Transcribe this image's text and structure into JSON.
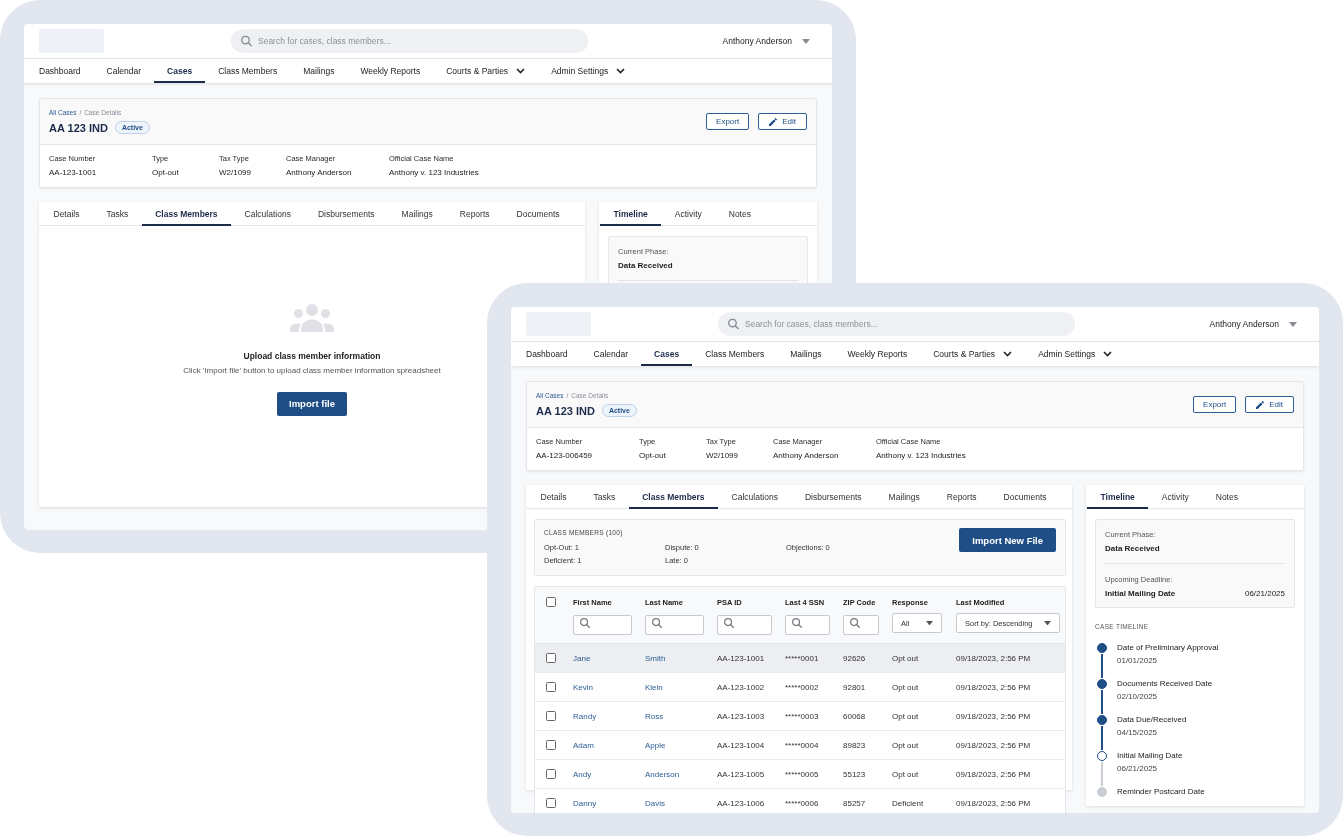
{
  "windows": [
    {
      "search": {
        "placeholder": "Search for cases, class members..."
      },
      "user": {
        "name": "Anthony Anderson"
      },
      "nav": [
        {
          "label": "Dashboard",
          "selected": false,
          "menu": false
        },
        {
          "label": "Calendar",
          "selected": false,
          "menu": false
        },
        {
          "label": "Cases",
          "selected": true,
          "menu": false
        },
        {
          "label": "Class Members",
          "selected": false,
          "menu": false
        },
        {
          "label": "Mailings",
          "selected": false,
          "menu": false
        },
        {
          "label": "Weekly Reports",
          "selected": false,
          "menu": false
        },
        {
          "label": "Courts & Parties",
          "selected": false,
          "menu": true
        },
        {
          "label": "Admin Settings",
          "selected": false,
          "menu": true
        }
      ],
      "breadcrumb": {
        "link": "All Cases",
        "separator": "/",
        "current": "Case Details"
      },
      "case": {
        "title": "AA 123 IND",
        "status": "Active"
      },
      "actions": [
        {
          "label": "Export",
          "kind": "plain"
        },
        {
          "label": "Edit",
          "kind": "edit"
        }
      ],
      "fields": [
        {
          "label": "Case Number",
          "value": "AA-123-1001"
        },
        {
          "label": "Type",
          "value": "Opt-out"
        },
        {
          "label": "Tax Type",
          "value": "W2/1099"
        },
        {
          "label": "Case Manager",
          "value": "Anthony Anderson"
        },
        {
          "label": "Official Case Name",
          "value": "Anthony v. 123 Industries"
        }
      ],
      "tabs": [
        {
          "label": "Details",
          "selected": false
        },
        {
          "label": "Tasks",
          "selected": false
        },
        {
          "label": "Class Members",
          "selected": true
        },
        {
          "label": "Calculations",
          "selected": false
        },
        {
          "label": "Disbursements",
          "selected": false
        },
        {
          "label": "Mailings",
          "selected": false
        },
        {
          "label": "Reports",
          "selected": false
        },
        {
          "label": "Documents",
          "selected": false
        }
      ],
      "content": {
        "kind": "empty_state",
        "title": "Upload class member information",
        "message": "Click 'Import file' button to upload class member information spreadsheet",
        "button": "Import file"
      },
      "side_panel": {
        "tabs": [
          {
            "label": "Timeline",
            "selected": true
          },
          {
            "label": "Activity",
            "selected": false
          },
          {
            "label": "Notes",
            "selected": false
          }
        ],
        "summary": {
          "phase_label": "Current Phase:",
          "phase": "Data Received"
        }
      }
    },
    {
      "search": {
        "placeholder": "Search for cases, class members..."
      },
      "user": {
        "name": "Anthony Anderson"
      },
      "nav": [
        {
          "label": "Dashboard",
          "selected": false,
          "menu": false
        },
        {
          "label": "Calendar",
          "selected": false,
          "menu": false
        },
        {
          "label": "Cases",
          "selected": true,
          "menu": false
        },
        {
          "label": "Class Members",
          "selected": false,
          "menu": false
        },
        {
          "label": "Mailings",
          "selected": false,
          "menu": false
        },
        {
          "label": "Weekly Reports",
          "selected": false,
          "menu": false
        },
        {
          "label": "Courts & Parties",
          "selected": false,
          "menu": true
        },
        {
          "label": "Admin Settings",
          "selected": false,
          "menu": true
        }
      ],
      "breadcrumb": {
        "link": "All Cases",
        "separator": "/",
        "current": "Case Details"
      },
      "case": {
        "title": "AA 123 IND",
        "status": "Active"
      },
      "actions": [
        {
          "label": "Export",
          "kind": "plain"
        },
        {
          "label": "Edit",
          "kind": "edit"
        }
      ],
      "fields": [
        {
          "label": "Case Number",
          "value": "AA-123-006459"
        },
        {
          "label": "Type",
          "value": "Opt-out"
        },
        {
          "label": "Tax Type",
          "value": "W2/1099"
        },
        {
          "label": "Case Manager",
          "value": "Anthony Anderson"
        },
        {
          "label": "Official Case Name",
          "value": "Anthony v. 123 Industries"
        }
      ],
      "tabs": [
        {
          "label": "Details",
          "selected": false
        },
        {
          "label": "Tasks",
          "selected": false
        },
        {
          "label": "Class Members",
          "selected": true
        },
        {
          "label": "Calculations",
          "selected": false
        },
        {
          "label": "Disbursements",
          "selected": false
        },
        {
          "label": "Mailings",
          "selected": false
        },
        {
          "label": "Reports",
          "selected": false
        },
        {
          "label": "Documents",
          "selected": false
        }
      ],
      "content": {
        "kind": "table",
        "title": "CLASS MEMBERS (100)",
        "stats": [
          "Opt-Out: 1",
          "Dispute: 0",
          "Objections: 0",
          "Deficient: 1",
          "Late: 0"
        ],
        "button": "Import New File",
        "select_all": {
          "checked": false
        },
        "columns": [
          {
            "label": "First Name",
            "kind": "search",
            "link": true
          },
          {
            "label": "Last Name",
            "kind": "search",
            "link": true
          },
          {
            "label": "PSA ID",
            "kind": "search",
            "link": false
          },
          {
            "label": "Last 4 SSN",
            "kind": "search",
            "link": false
          },
          {
            "label": "ZIP Code",
            "kind": "search",
            "link": false
          },
          {
            "label": "Response",
            "kind": "select",
            "value": "All",
            "link": false
          },
          {
            "label": "Last Modified",
            "kind": "select",
            "value": "Sort by: Descending",
            "link": false
          }
        ],
        "rows": [
          {
            "checked": false,
            "hovered": true,
            "cells": [
              "Jane",
              "Smith",
              "AA-123-1001",
              "*****0001",
              "92626",
              "Opt out",
              "09/18/2023, 2:56 PM"
            ]
          },
          {
            "checked": false,
            "hovered": false,
            "cells": [
              "Kevin",
              "Klein",
              "AA-123-1002",
              "*****0002",
              "92801",
              "Opt out",
              "09/18/2023, 2:56 PM"
            ]
          },
          {
            "checked": false,
            "hovered": false,
            "cells": [
              "Randy",
              "Ross",
              "AA-123-1003",
              "*****0003",
              "60068",
              "Opt out",
              "09/18/2023, 2:56 PM"
            ]
          },
          {
            "checked": false,
            "hovered": false,
            "cells": [
              "Adam",
              "Apple",
              "AA-123-1004",
              "*****0004",
              "89823",
              "Opt out",
              "09/18/2023, 2:56 PM"
            ]
          },
          {
            "checked": false,
            "hovered": false,
            "cells": [
              "Andy",
              "Anderson",
              "AA-123-1005",
              "*****0005",
              "55123",
              "Opt out",
              "09/18/2023, 2:56 PM"
            ]
          },
          {
            "checked": false,
            "hovered": false,
            "cells": [
              "Danny",
              "Davis",
              "AA-123-1006",
              "*****0006",
              "85257",
              "Deficient",
              "09/18/2023, 2:56 PM"
            ]
          }
        ]
      },
      "side_panel": {
        "tabs": [
          {
            "label": "Timeline",
            "selected": true
          },
          {
            "label": "Activity",
            "selected": false
          },
          {
            "label": "Notes",
            "selected": false
          }
        ],
        "summary": {
          "phase_label": "Current Phase:",
          "phase": "Data Received",
          "deadline_label": "Upcoming Deadline:",
          "deadline_name": "Initial Mailing Date",
          "deadline_date": "06/21/2025"
        },
        "timeline_title": "CASE TIMELINE",
        "timeline": [
          {
            "title": "Date of Preliminary Approval",
            "date": "01/01/2025",
            "kind": "done"
          },
          {
            "title": "Documents Received Date",
            "date": "02/10/2025",
            "kind": "done"
          },
          {
            "title": "Data Due/Received",
            "date": "04/15/2025",
            "kind": "done"
          },
          {
            "title": "Initial Mailing Date",
            "date": "06/21/2025",
            "kind": "next"
          },
          {
            "title": "Reminder Postcard Date",
            "kind": "future"
          }
        ]
      }
    }
  ]
}
